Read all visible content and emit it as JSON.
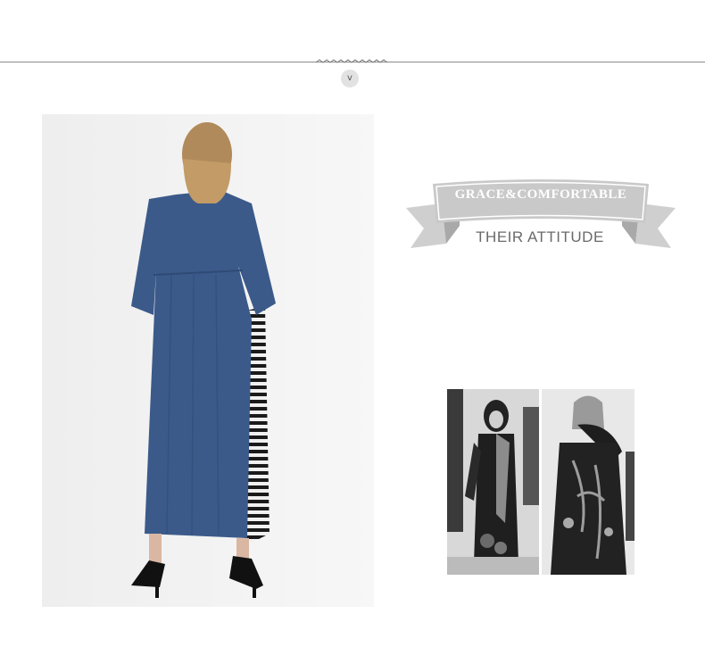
{
  "header": {
    "toggle_glyph": "v",
    "toggle_icon": "chevron-down-icon"
  },
  "banner": {
    "title": "GRACE&COMFORTABLE",
    "subtitle": "THEIR ATTITUDE"
  },
  "colors": {
    "ribbon": "#c9c9c9",
    "ribbon_dark": "#a8a8a8",
    "divider": "#8a8a8a",
    "dress": "#3b5a8a"
  }
}
